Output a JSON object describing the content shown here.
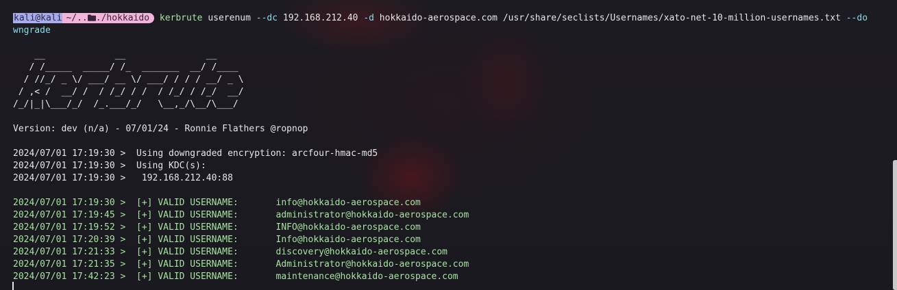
{
  "prompt": {
    "user": "kali@kali",
    "path_prefix": "~/..",
    "folder_icon": "folder-icon",
    "path_suffix": "./hokkaido"
  },
  "command": {
    "name": "kerbrute",
    "line1_args": " userenum ",
    "flag1": "--dc",
    "arg1": " 192.168.212.40 ",
    "flag2": "-d",
    "arg2": " hokkaido-aerospace.com /usr/share/seclists/Usernames/xato-net-10-million-usernames.txt ",
    "flag3_start": "--do",
    "flag3_rest": "wngrade"
  },
  "banner": [
    "    __             __               __",
    "   / /_____  _____/ /_  _______  __/ /____",
    "  / //_/ _ \\/ ___/ __ \\/ ___/ / / / __/ _ \\",
    " / ,< /  __/ /  / /_/ / /  / /_/ / /_/  __/",
    "/_/|_|\\___/_/  /_.___/_/   \\__,_/\\__/\\___/"
  ],
  "version_line": "Version: dev (n/a) - 07/01/24 - Ronnie Flathers @ropnop",
  "info_lines": [
    {
      "ts": "2024/07/01 17:19:30 >",
      "msg": "  Using downgraded encryption: arcfour-hmac-md5"
    },
    {
      "ts": "2024/07/01 17:19:30 >",
      "msg": "  Using KDC(s):"
    },
    {
      "ts": "2024/07/01 17:19:30 >",
      "msg": "   192.168.212.40:88"
    }
  ],
  "valid_label": "  [+] VALID USERNAME:       ",
  "valid_users": [
    {
      "ts": "2024/07/01 17:19:30 >",
      "user": "info@hokkaido-aerospace.com"
    },
    {
      "ts": "2024/07/01 17:19:45 >",
      "user": "administrator@hokkaido-aerospace.com"
    },
    {
      "ts": "2024/07/01 17:19:52 >",
      "user": "INFO@hokkaido-aerospace.com"
    },
    {
      "ts": "2024/07/01 17:20:39 >",
      "user": "Info@hokkaido-aerospace.com"
    },
    {
      "ts": "2024/07/01 17:21:33 >",
      "user": "discovery@hokkaido-aerospace.com"
    },
    {
      "ts": "2024/07/01 17:21:35 >",
      "user": "Administrator@hokkaido-aerospace.com"
    },
    {
      "ts": "2024/07/01 17:42:23 >",
      "user": "maintenance@hokkaido-aerospace.com"
    }
  ],
  "colors": {
    "background": "#1b1a20",
    "prompt_user_bg": "#a8acec",
    "prompt_path_bg": "#f3b4da",
    "command": "#a6e3a1",
    "flag": "#89dceb",
    "valid": "#a6e3a1"
  }
}
